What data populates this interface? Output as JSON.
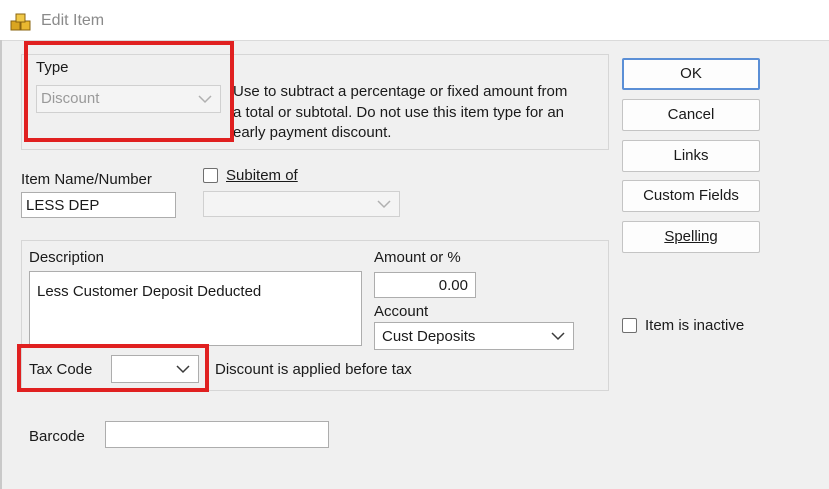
{
  "window": {
    "title": "Edit Item",
    "icon": "item-list-icon"
  },
  "type_section": {
    "label": "Type",
    "selected": "Discount",
    "description": [
      "Use to subtract a percentage or fixed amount from",
      "a total or subtotal. Do not use this item type for an",
      "early payment discount."
    ]
  },
  "item": {
    "name_label": "Item Name/Number",
    "name_value": "LESS DEP",
    "subitem_label": "Subitem of",
    "subitem_value": "",
    "subitem_checked": false
  },
  "details": {
    "description_label": "Description",
    "description_value": "Less Customer Deposit Deducted",
    "amount_label": "Amount or %",
    "amount_value": "0.00",
    "account_label": "Account",
    "account_value": "Cust Deposits",
    "tax_code_label": "Tax Code",
    "tax_code_value": "",
    "tax_note": "Discount is applied before tax"
  },
  "barcode": {
    "label": "Barcode",
    "value": ""
  },
  "buttons": {
    "ok": "OK",
    "cancel": "Cancel",
    "links": "Links",
    "custom_fields": "Custom Fields",
    "spelling": "Spelling"
  },
  "inactive": {
    "label": "Item is inactive",
    "checked": false
  },
  "colors": {
    "highlight": "#e02020",
    "default_button_border": "#5b8fd6"
  }
}
